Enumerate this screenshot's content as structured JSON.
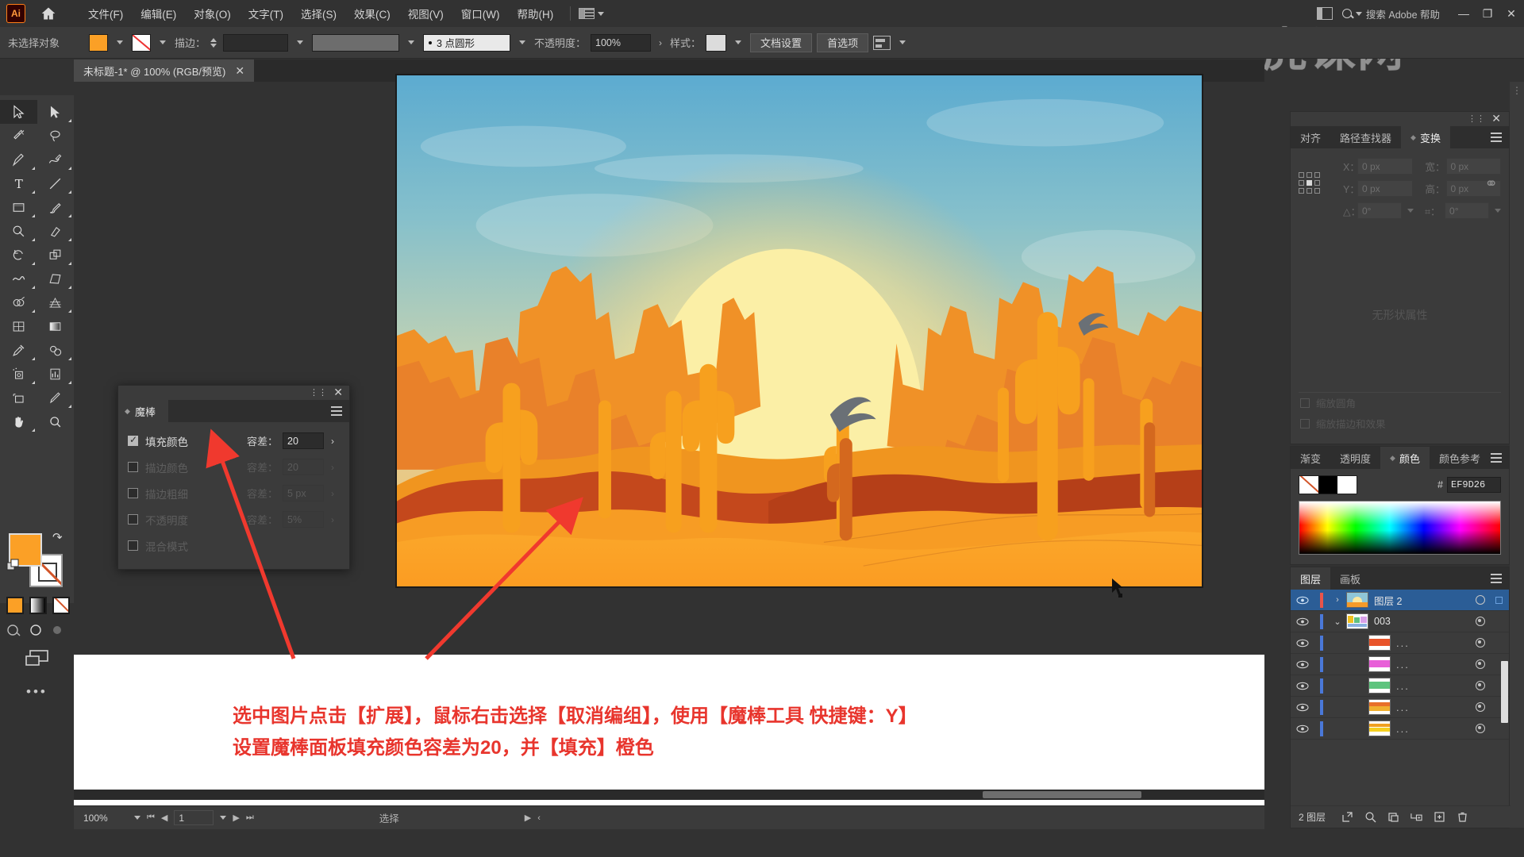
{
  "app": {
    "logo": "Ai",
    "watermark": "虎课网"
  },
  "menubar": {
    "home_icon": "home-icon",
    "items": [
      {
        "label": "文件(F)"
      },
      {
        "label": "编辑(E)"
      },
      {
        "label": "对象(O)"
      },
      {
        "label": "文字(T)"
      },
      {
        "label": "选择(S)"
      },
      {
        "label": "效果(C)"
      },
      {
        "label": "视图(V)"
      },
      {
        "label": "窗口(W)"
      },
      {
        "label": "帮助(H)"
      }
    ],
    "workspace_switcher": "workspace-switcher",
    "search_placeholder": "搜索 Adobe 帮助",
    "window_controls": {
      "minimize": "—",
      "restore": "❐",
      "close": "✕"
    }
  },
  "controlbar": {
    "selection_status": "未选择对象",
    "fill_color": "#FBA026",
    "stroke_label": "描边：",
    "stroke_weight": "",
    "stroke_profile": "",
    "brush_label": "3 点圆形",
    "opacity_label": "不透明度：",
    "opacity_value": "100%",
    "style_label": "样式：",
    "doc_setup_button": "文档设置",
    "preferences_button": "首选项",
    "align_icon": "align-icon"
  },
  "document_tab": {
    "title": "未标题-1* @ 100% (RGB/预览)",
    "close": "✕"
  },
  "toolbar": {
    "tools": [
      {
        "name": "selection-tool",
        "active": true
      },
      {
        "name": "direct-selection-tool",
        "active": false
      },
      {
        "name": "magic-wand-tool",
        "active": false
      },
      {
        "name": "lasso-tool",
        "active": false
      },
      {
        "name": "pen-tool",
        "active": false
      },
      {
        "name": "curvature-tool",
        "active": false
      },
      {
        "name": "type-tool",
        "active": false
      },
      {
        "name": "line-segment-tool",
        "active": false
      },
      {
        "name": "rectangle-tool",
        "active": false
      },
      {
        "name": "paintbrush-tool",
        "active": false
      },
      {
        "name": "shaper-tool",
        "active": false
      },
      {
        "name": "eraser-tool",
        "active": false
      },
      {
        "name": "rotate-tool",
        "active": false
      },
      {
        "name": "scale-tool",
        "active": false
      },
      {
        "name": "width-tool",
        "active": false
      },
      {
        "name": "free-transform-tool",
        "active": false
      },
      {
        "name": "shape-builder-tool",
        "active": false
      },
      {
        "name": "perspective-grid-tool",
        "active": false
      },
      {
        "name": "mesh-tool",
        "active": false
      },
      {
        "name": "gradient-tool",
        "active": false
      },
      {
        "name": "eyedropper-tool",
        "active": false
      },
      {
        "name": "blend-tool",
        "active": false
      },
      {
        "name": "symbol-sprayer-tool",
        "active": false
      },
      {
        "name": "column-graph-tool",
        "active": false
      },
      {
        "name": "artboard-tool",
        "active": false
      },
      {
        "name": "slice-tool",
        "active": false
      },
      {
        "name": "hand-tool",
        "active": false
      },
      {
        "name": "zoom-tool",
        "active": false
      }
    ],
    "fill_swatch_color": "#FBA026",
    "stroke_swatch": "none",
    "mode_color": "#FBA026",
    "more_tools": "•••"
  },
  "magic_wand_panel": {
    "tab_label": "魔棒",
    "close": "✕",
    "rows": [
      {
        "label": "填充颜色",
        "checked": true,
        "tol_label": "容差：",
        "tol_value": "20",
        "enabled": true
      },
      {
        "label": "描边颜色",
        "checked": false,
        "tol_label": "容差：",
        "tol_value": "20",
        "enabled": false
      },
      {
        "label": "描边粗细",
        "checked": false,
        "tol_label": "容差：",
        "tol_value": "5 px",
        "enabled": false
      },
      {
        "label": "不透明度",
        "checked": false,
        "tol_label": "容差：",
        "tol_value": "5%",
        "enabled": false
      },
      {
        "label": "混合模式",
        "checked": false,
        "tol_label": "",
        "tol_value": "",
        "enabled": false
      }
    ]
  },
  "transform_panel": {
    "tabs": [
      {
        "label": "对齐",
        "active": false
      },
      {
        "label": "路径查找器",
        "active": false
      },
      {
        "label": "变换",
        "active": true
      }
    ],
    "fields": {
      "x_key": "X：",
      "x_value": "0 px",
      "y_key": "Y：",
      "y_value": "0 px",
      "w_key": "宽：",
      "w_value": "0 px",
      "h_key": "高：",
      "h_value": "0 px",
      "angle_key": "△：",
      "angle_value": "0°",
      "shear_key": "⌗：",
      "shear_value": "0°"
    },
    "empty_text": "无形状属性",
    "options": [
      {
        "label": "缩放圆角"
      },
      {
        "label": "缩放描边和效果"
      }
    ]
  },
  "color_panel": {
    "tabs": [
      {
        "label": "渐变",
        "active": false
      },
      {
        "label": "透明度",
        "active": false
      },
      {
        "label": "颜色",
        "active": true
      },
      {
        "label": "颜色参考",
        "active": false
      }
    ],
    "hash": "#",
    "hex_value": "EF9D26",
    "swatches": [
      "none",
      "#000000",
      "#FFFFFF"
    ]
  },
  "layers_panel": {
    "tabs": [
      {
        "label": "图层",
        "active": true
      },
      {
        "label": "画板",
        "active": false
      }
    ],
    "rows": [
      {
        "name": "图层 2",
        "selected": true,
        "indent": 0,
        "thumb": "artwork",
        "expand": "›",
        "bar_color": "#e8544a"
      },
      {
        "name": "003",
        "selected": false,
        "indent": 0,
        "thumb": "group",
        "expand": "⌄",
        "bar_color": "#4a78d8"
      },
      {
        "name": "...",
        "selected": false,
        "indent": 1,
        "thumb": "#e8542a",
        "expand": "",
        "bar_color": "#4a78d8"
      },
      {
        "name": "...",
        "selected": false,
        "indent": 1,
        "thumb": "#e860d8",
        "expand": "",
        "bar_color": "#4a78d8"
      },
      {
        "name": "...",
        "selected": false,
        "indent": 1,
        "thumb": "#5ec47e",
        "expand": "",
        "bar_color": "#4a78d8"
      },
      {
        "name": "...",
        "selected": false,
        "indent": 1,
        "thumb": "#f0a030",
        "expand": "",
        "bar_color": "#4a78d8"
      },
      {
        "name": "...",
        "selected": false,
        "indent": 1,
        "thumb": "#f5d020",
        "expand": "",
        "bar_color": "#4a78d8"
      }
    ],
    "footer_count": "2 图层",
    "footer_buttons": [
      "locate-object",
      "search-layer",
      "create-sublayer",
      "make-clipping-mask",
      "new-layer",
      "delete-layer"
    ]
  },
  "annotation": {
    "line1": "选中图片点击【扩展】，鼠标右击选择【取消编组】，使用【魔棒工具 快捷键：Y】",
    "line2": "设置魔棒面板填充颜色容差为20，并【填充】橙色",
    "color": "#e8352d"
  },
  "statusbar": {
    "zoom": "100%",
    "page": "1",
    "status_text": "选择"
  },
  "artwork": {
    "title": "desert-sunset-illustration",
    "sky_top": "#6fb4d2",
    "sky_mid": "#9ec9c6",
    "sun_color": "#fbefa6",
    "sand_color": "#fba02a",
    "dune_dark": "#c4451a",
    "cactus_color": "#f7a01e"
  }
}
